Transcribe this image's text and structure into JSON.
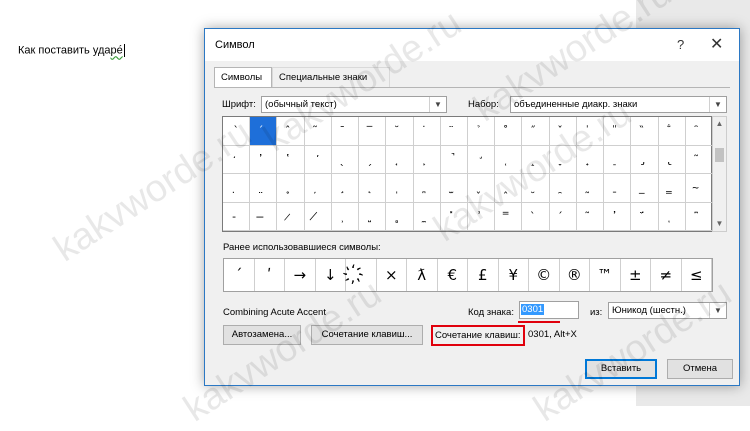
{
  "document": {
    "text_before": "Как поставить уда",
    "text_accented": "ре́"
  },
  "dialog": {
    "title": "Символ",
    "help": "?",
    "close": "✕",
    "tabs": [
      "Символы",
      "Специальные знаки"
    ],
    "font_label": "Шрифт:",
    "font_value": "(обычный текст)",
    "subset_label": "Набор:",
    "subset_value": "объединенные диакр. знаки",
    "grid": [
      [
        "ˋ",
        "́",
        "̂",
        "̃",
        "̄",
        "̅",
        "̆",
        "̇",
        "̈",
        "̉",
        "̊",
        "̋",
        "̌",
        "̍",
        "̎",
        "̏",
        "̐",
        "̑"
      ],
      [
        "̒",
        "̓",
        "̔",
        "̕",
        "̖",
        "̗",
        "̘",
        "̙",
        "̚",
        "̛",
        "̜",
        "̝",
        "̞",
        "̟",
        "̠",
        "̡",
        "̢",
        "̃"
      ],
      [
        "̣",
        "̤",
        "̥",
        "̦",
        "̧",
        "̨",
        "̩",
        "̪",
        "̫",
        "̬",
        "̭",
        "̮",
        "̯",
        "̰",
        "̱",
        "̲",
        "̳",
        "̴"
      ],
      [
        "̵",
        "̶",
        "̷",
        "̸",
        "̹",
        "̺",
        "̻",
        "̼",
        "̽",
        "̾",
        "̿",
        "̀",
        "́",
        "͂",
        "̓",
        "̈́",
        "ͅ",
        "͆"
      ]
    ],
    "recent_label": "Ранее использовавшиеся символы:",
    "recent": [
      "ˊ",
      "ʹ",
      "→",
      "↓",
      "҉",
      "×",
      "ƛ",
      "€",
      "£",
      "¥",
      "©",
      "®",
      "™",
      "±",
      "≠",
      "≤",
      "≥",
      "÷"
    ],
    "char_name": "Combining Acute Accent",
    "code_label": "Код знака:",
    "code_value": "0301",
    "from_label": "из:",
    "from_value": "Юникод (шестн.)",
    "autocorrect_button": "Автозамена...",
    "shortcut_button": "Сочетание клавиш...",
    "shortcut_label": "Сочетание клавиш:",
    "shortcut_value": "0301, Alt+X",
    "insert_button": "Вставить",
    "cancel_button": "Отмена"
  },
  "watermark": "kakvworde.ru"
}
